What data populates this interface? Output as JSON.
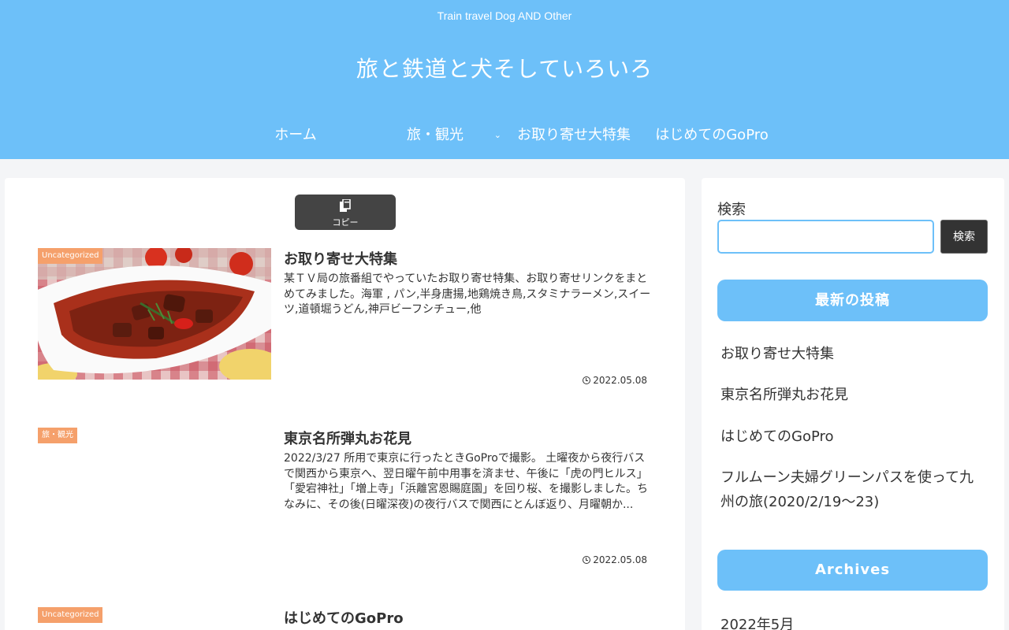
{
  "header": {
    "tagline": "Train travel Dog AND Other",
    "site_title": "旅と鉄道と犬そしていろいろ",
    "colors": {
      "header_bg": "#6dc0f9",
      "text": "#ffffff"
    }
  },
  "nav": {
    "items": [
      {
        "label": "ホーム"
      },
      {
        "label": "旅・観光",
        "icon": "chevron-down-icon"
      },
      {
        "label": "お取り寄せ大特集"
      },
      {
        "label": "はじめてのGoPro"
      }
    ]
  },
  "main": {
    "copy_button": {
      "label": "コピー",
      "icon": "copy-icon"
    },
    "posts": [
      {
        "category": "Uncategorized",
        "title": "お取り寄せ大特集",
        "excerpt": "某ＴＶ局の旅番組でやっていたお取り寄せ特集、お取り寄せリンクをまとめてみました。海軍 , パン,半身唐揚,地鶏焼き鳥,スタミナラーメン,スイーツ,道頓堀うどん,神戸ビーフシチュー,他",
        "date": "2022.05.08",
        "thumbnail": "beef-stew-photo"
      },
      {
        "category": "旅・観光",
        "title": "東京名所弾丸お花見",
        "excerpt": "2022/3/27 所用で東京に行ったときGoProで撮影。 土曜夜から夜行バスで関西から東京へ、翌日曜午前中用事を済ませ、午後に「虎の門ヒルス」「愛宕神社」「増上寺」「浜離宮恩賜庭園」を回り桜、を撮影しました。ちなみに、その後(日曜深夜)の夜行バスで関西にとんぼ返り、月曜朝か...",
        "date": "2022.05.08"
      },
      {
        "category": "Uncategorized",
        "title": "はじめてのGoPro"
      }
    ],
    "colors": {
      "badge": "#f5a06b",
      "copy_button": "#444444"
    }
  },
  "sidebar": {
    "search": {
      "label": "検索",
      "placeholder": "",
      "button_label": "検索"
    },
    "recent": {
      "heading": "最新の投稿",
      "items": [
        "お取り寄せ大特集",
        "東京名所弾丸お花見",
        "はじめてのGoPro",
        "フルムーン夫婦グリーンパスを使って九州の旅(2020/2/19～23)"
      ]
    },
    "archives": {
      "heading": "Archives",
      "items": [
        "2022年5月"
      ]
    }
  }
}
